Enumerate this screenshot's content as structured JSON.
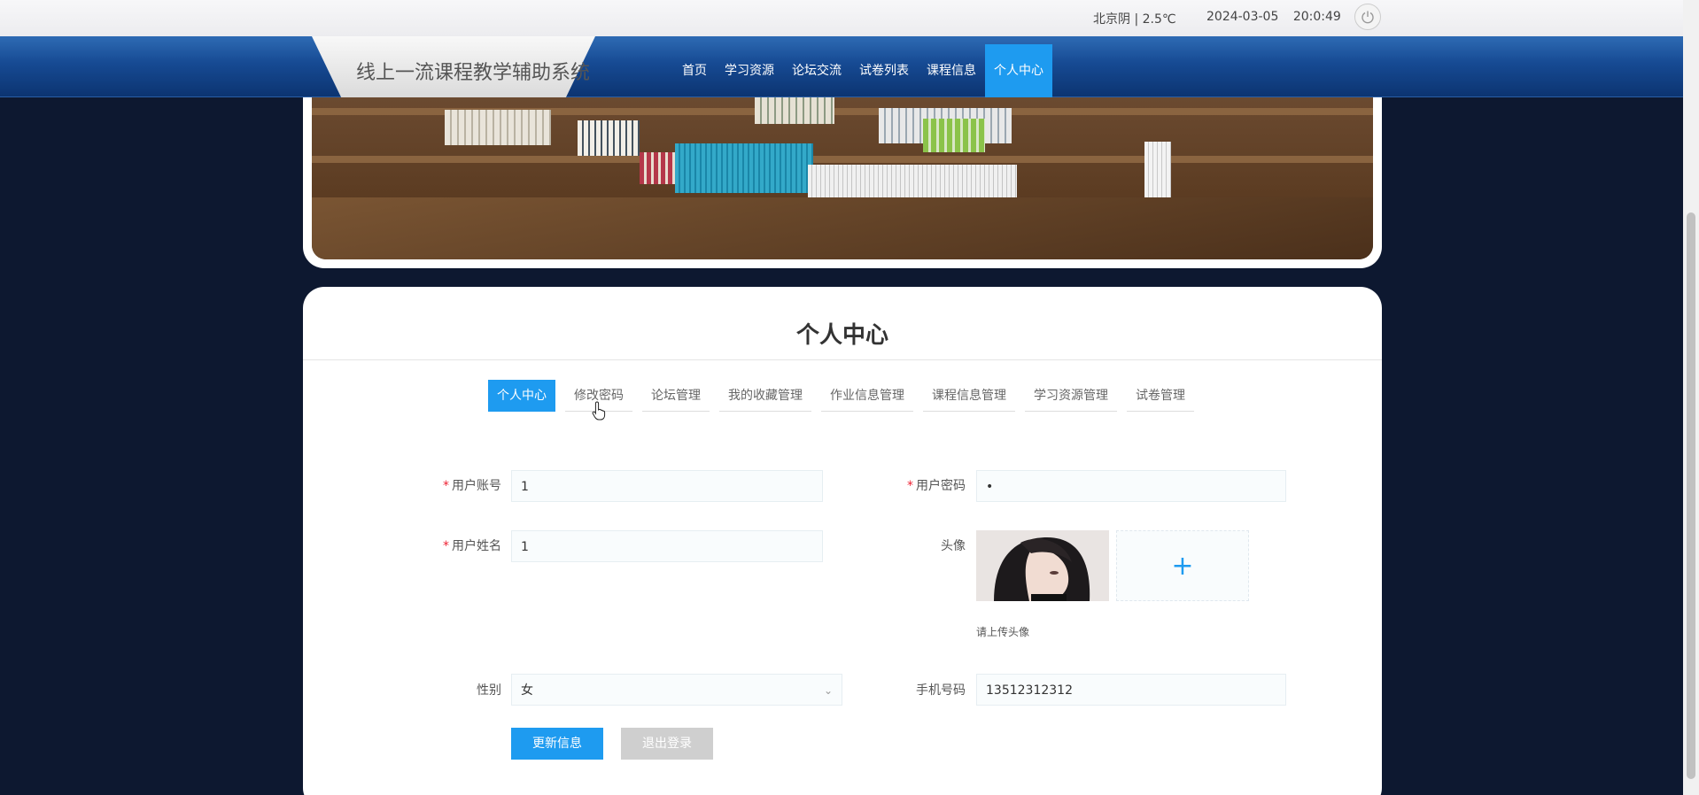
{
  "topbar": {
    "weather": "北京阴 | 2.5℃",
    "date": "2024-03-05",
    "time": "20:0:49",
    "power_icon": "power-icon"
  },
  "nav": {
    "brand_title": "线上一流课程教学辅助系统",
    "items": [
      {
        "label": "首页"
      },
      {
        "label": "学习资源"
      },
      {
        "label": "论坛交流"
      },
      {
        "label": "试卷列表"
      },
      {
        "label": "课程信息"
      },
      {
        "label": "个人中心",
        "active": true
      }
    ]
  },
  "card": {
    "title": "个人中心",
    "tabs": [
      {
        "label": "个人中心",
        "active": true
      },
      {
        "label": "修改密码"
      },
      {
        "label": "论坛管理"
      },
      {
        "label": "我的收藏管理"
      },
      {
        "label": "作业信息管理"
      },
      {
        "label": "课程信息管理"
      },
      {
        "label": "学习资源管理"
      },
      {
        "label": "试卷管理"
      }
    ]
  },
  "form": {
    "account_label": "用户账号",
    "account_value": "1",
    "password_label": "用户密码",
    "password_value": "•",
    "name_label": "用户姓名",
    "name_value": "1",
    "avatar_label": "头像",
    "avatar_hint": "请上传头像",
    "upload_plus": "+",
    "gender_label": "性别",
    "gender_value": "女",
    "phone_label": "手机号码",
    "phone_value": "13512312312",
    "update_button": "更新信息",
    "logout_button": "退出登录"
  },
  "colors": {
    "accent": "#1e9bf0",
    "nav_bg": "#164a93",
    "page_bg": "#0d1830"
  }
}
